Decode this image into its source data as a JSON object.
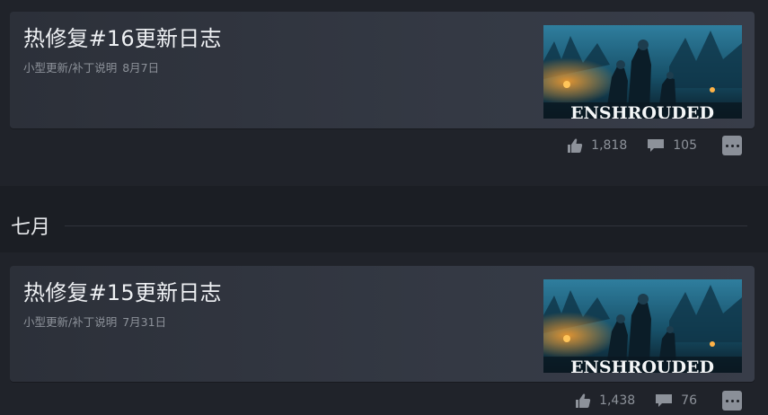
{
  "posts": [
    {
      "title": "热修复#16更新日志",
      "category": "小型更新/补丁说明",
      "date": "8月7日",
      "image_text": "ENSHROUDED",
      "likes": "1,818",
      "comments": "105"
    },
    {
      "title": "热修复#15更新日志",
      "category": "小型更新/补丁说明",
      "date": "7月31日",
      "image_text": "ENSHROUDED",
      "likes": "1,438",
      "comments": "76"
    }
  ],
  "section": {
    "label": "七月"
  },
  "icons": {
    "like": "thumbs-up-icon",
    "comment": "speech-bubble-icon",
    "more": "more-options-icon"
  },
  "colors": {
    "background": "#1b1e24",
    "card": "#343944",
    "muted_text": "#8d929a",
    "title_text": "#eef0f3"
  }
}
